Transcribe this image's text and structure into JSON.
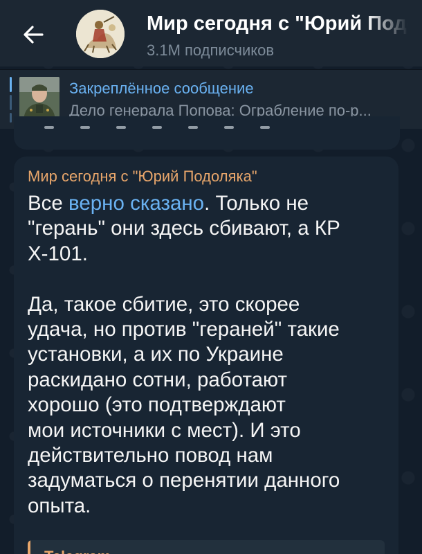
{
  "header": {
    "title": "Мир сегодня с \"Юрий Подоляка\"",
    "subscribers": "3.1M подписчиков",
    "back_icon": "arrow-left-icon",
    "colors": {
      "background": "#1c2733",
      "title": "#ffffff",
      "subtitle": "#7d8b99"
    }
  },
  "pinned": {
    "label": "Закреплённое сообщение",
    "text": "Дело генерала Попова: Ограбление по-р...",
    "colors": {
      "label": "#6ab2f2",
      "text": "#8a96a3"
    }
  },
  "message": {
    "sender": "Мир сегодня с \"Юрий Подоляка\"",
    "lines": [
      "Все ",
      "верно сказано",
      ". Только не",
      "\"герань\" они здесь сбивают, а КР",
      "Х-101.",
      "Да, такое сбитие, это скорее",
      "удача, но против \"гераней\" такие",
      "установки, а их по Украине",
      "раскидано сотни, работают",
      "хорошо (это подтверждают",
      "мои источники с мест). И это",
      "действительно повод нам",
      "задуматься о перенятии данного",
      "опыта."
    ],
    "link_preview_site": "Telegram",
    "colors": {
      "sender": "#e8a66b",
      "text": "#f5f5f5",
      "link": "#6ab2f2",
      "bubble": "#182533"
    }
  }
}
